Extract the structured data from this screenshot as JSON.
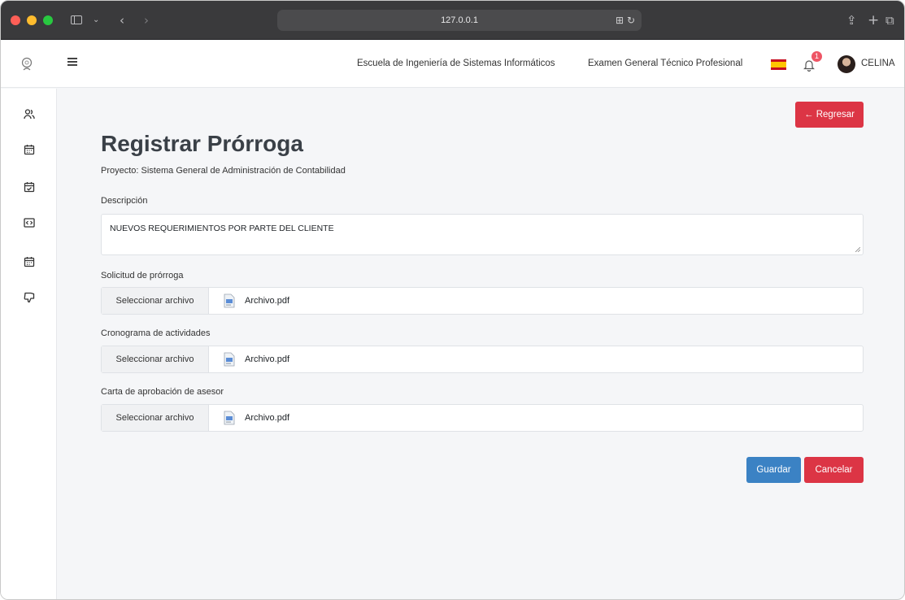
{
  "browser": {
    "url": "127.0.0.1",
    "icons": [
      "sidebar-toggle-icon",
      "chevron-down-icon",
      "back-arrow-icon",
      "forward-arrow-icon",
      "translate-icon",
      "reload-icon",
      "share-icon",
      "new-tab-icon",
      "tabs-overview-icon"
    ]
  },
  "header": {
    "school": "Escuela de Ingeniería de Sistemas Informáticos",
    "exam": "Examen General Técnico Profesional",
    "notification_count": "1",
    "user_name": "CELINA"
  },
  "sidebar": {
    "items": [
      {
        "icon": "users-icon"
      },
      {
        "icon": "calendar-icon"
      },
      {
        "icon": "calendar-check-icon"
      },
      {
        "icon": "code-icon"
      },
      {
        "icon": "calendar-icon"
      },
      {
        "icon": "thumbs-down-icon"
      }
    ]
  },
  "main": {
    "back_button": "← Regresar",
    "title": "Registrar Prórroga",
    "project": "Proyecto: Sistema General de Administración de Contabilidad",
    "description_label": "Descripción",
    "description_value": "NUEVOS REQUERIMIENTOS POR PARTE DEL CLIENTE",
    "files": [
      {
        "label": "Solicitud de prórroga",
        "button": "Seleccionar archivo",
        "file_name": "Archivo.pdf"
      },
      {
        "label": "Cronograma de actividades",
        "button": "Seleccionar archivo",
        "file_name": "Archivo.pdf"
      },
      {
        "label": "Carta de aprobación de asesor",
        "button": "Seleccionar archivo",
        "file_name": "Archivo.pdf"
      }
    ],
    "save_button": "Guardar",
    "cancel_button": "Cancelar"
  },
  "colors": {
    "danger": "#dc3545",
    "primary": "#3b82c4",
    "background": "#f5f6f8"
  }
}
